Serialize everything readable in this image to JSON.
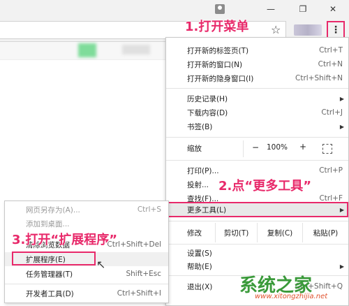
{
  "window": {
    "minimize": "—",
    "maximize": "❐",
    "close": "✕"
  },
  "toolbar": {
    "menu_icon": "⋮",
    "star_icon": "☆"
  },
  "annotations": {
    "step1": "1.打开菜单",
    "step2": "2.点“更多工具”",
    "step3": "3.打开“扩展程序”",
    "color": "#e8296a"
  },
  "menu": {
    "new_tab": {
      "label": "打开新的标签页(T)",
      "shortcut": "Ctrl+T"
    },
    "new_window": {
      "label": "打开新的窗口(N)",
      "shortcut": "Ctrl+N"
    },
    "incognito": {
      "label": "打开新的隐身窗口(I)",
      "shortcut": "Ctrl+Shift+N"
    },
    "history": {
      "label": "历史记录(H)"
    },
    "downloads": {
      "label": "下载内容(D)",
      "shortcut": "Ctrl+J"
    },
    "bookmarks": {
      "label": "书签(B)"
    },
    "zoom": {
      "label": "缩放",
      "minus": "−",
      "value": "100%",
      "plus": "+"
    },
    "print": {
      "label": "打印(P)...",
      "shortcut": "Ctrl+P"
    },
    "cast": {
      "label": "投射..."
    },
    "find": {
      "label": "查找(F)...",
      "shortcut": "Ctrl+F"
    },
    "more_tools": {
      "label": "更多工具(L)"
    },
    "edit": {
      "label": "修改",
      "cut": "剪切(T)",
      "copy": "复制(C)",
      "paste": "粘贴(P)"
    },
    "settings": {
      "label": "设置(S)"
    },
    "help": {
      "label": "帮助(E)"
    },
    "exit": {
      "label": "退出(X)",
      "shortcut": "Ctrl+Shift+Q"
    }
  },
  "submenu": {
    "save_page": {
      "label": "网页另存为(A)...",
      "shortcut": "Ctrl+S"
    },
    "add_to_desktop": {
      "label": "添加到桌面..."
    },
    "clear_data": {
      "label": "清除浏览数据",
      "shortcut": "Ctrl+Shift+Del"
    },
    "extensions": {
      "label": "扩展程序(E)"
    },
    "task_manager": {
      "label": "任务管理器(T)",
      "shortcut": "Shift+Esc"
    },
    "devtools": {
      "label": "开发者工具(D)",
      "shortcut": "Ctrl+Shift+I"
    }
  },
  "watermark": {
    "logo": "系统之家",
    "url": "www.xitongzhijia.net"
  }
}
